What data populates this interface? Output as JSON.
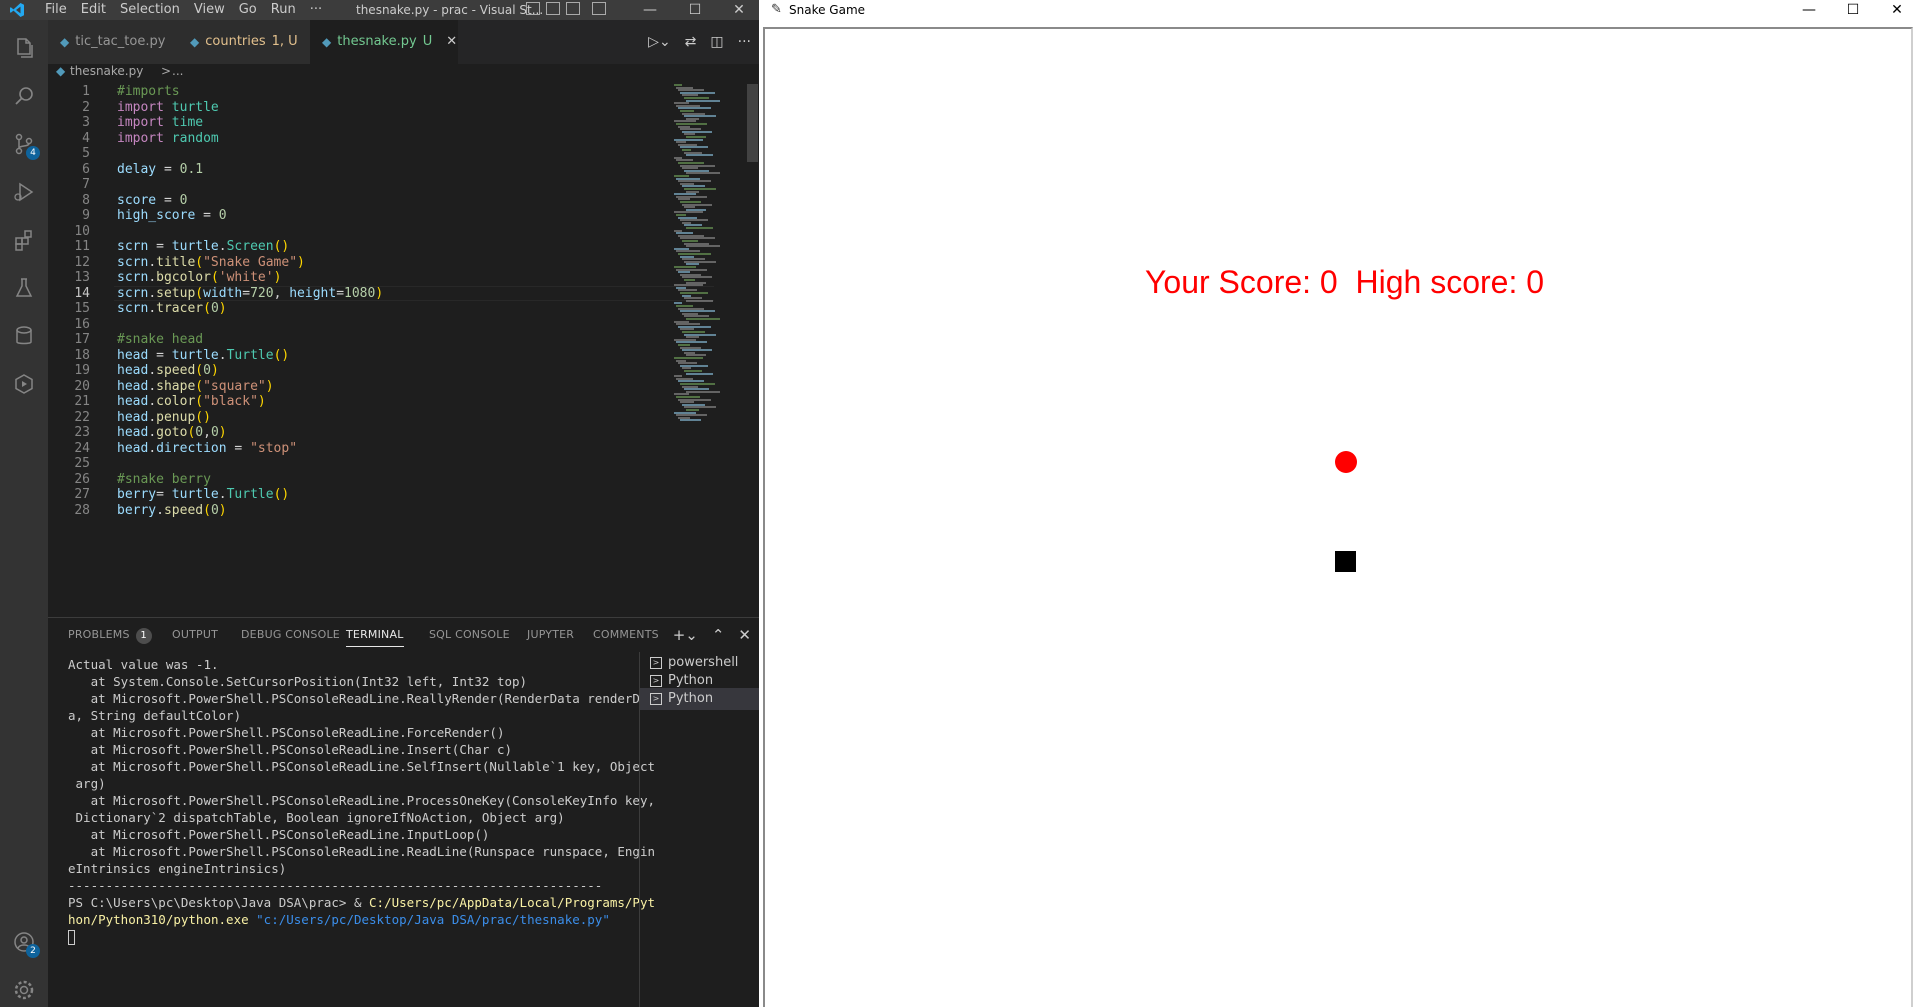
{
  "vscode": {
    "menu": [
      "File",
      "Edit",
      "Selection",
      "View",
      "Go",
      "Run",
      "···"
    ],
    "window_title": "thesnake.py - prac - Visual St...",
    "window_controls": {
      "minimize": "—",
      "maximize": "☐",
      "close": "✕"
    },
    "activity_badges": {
      "source_control": "4",
      "accounts": "2"
    },
    "tabs": [
      {
        "label": "tic_tac_toe.py",
        "status": ""
      },
      {
        "label": "countries",
        "status": "1, U"
      },
      {
        "label": "thesnake.py",
        "status": "U",
        "active": true
      }
    ],
    "breadcrumb": {
      "file": "thesnake.py",
      "sep": ">",
      "rest": "..."
    },
    "current_line": 14,
    "code_lines": [
      "#imports",
      "import turtle",
      "import time",
      "import random",
      "",
      "delay = 0.1",
      "",
      "score = 0",
      "high_score = 0",
      "",
      "scrn = turtle.Screen()",
      "scrn.title(\"Snake Game\")",
      "scrn.bgcolor('white')",
      "scrn.setup(width=720, height=1080)",
      "scrn.tracer(0)",
      "",
      "#snake head",
      "head = turtle.Turtle()",
      "head.speed(0)",
      "head.shape(\"square\")",
      "head.color(\"black\")",
      "head.penup()",
      "head.goto(0,0)",
      "head.direction = \"stop\"",
      "",
      "#snake berry",
      "berry= turtle.Turtle()",
      "berry.speed(0)"
    ],
    "panel": {
      "tabs": [
        "PROBLEMS",
        "OUTPUT",
        "DEBUG CONSOLE",
        "TERMINAL",
        "SQL CONSOLE",
        "JUPYTER",
        "COMMENTS"
      ],
      "problems_count": "1",
      "active_tab": "TERMINAL",
      "terminal_lines": [
        "Actual value was -1.",
        "   at System.Console.SetCursorPosition(Int32 left, Int32 top)",
        "   at Microsoft.PowerShell.PSConsoleReadLine.ReallyRender(RenderData renderDat",
        "a, String defaultColor)",
        "   at Microsoft.PowerShell.PSConsoleReadLine.ForceRender()",
        "   at Microsoft.PowerShell.PSConsoleReadLine.Insert(Char c)",
        "   at Microsoft.PowerShell.PSConsoleReadLine.SelfInsert(Nullable`1 key, Object",
        " arg)",
        "   at Microsoft.PowerShell.PSConsoleReadLine.ProcessOneKey(ConsoleKeyInfo key,",
        " Dictionary`2 dispatchTable, Boolean ignoreIfNoAction, Object arg)",
        "   at Microsoft.PowerShell.PSConsoleReadLine.InputLoop()",
        "   at Microsoft.PowerShell.PSConsoleReadLine.ReadLine(Runspace runspace, Engin",
        "eIntrinsics engineIntrinsics)",
        "-----------------------------------------------------------------------"
      ],
      "prompt": "PS C:\\Users\\pc\\Desktop\\Java DSA\\prac> & ",
      "command_path_line1": "C:/Users/pc/AppData/Local/Programs/Pyt",
      "command_path_line2": "hon/Python310/python.exe",
      "command_arg": " \"c:/Users/pc/Desktop/Java DSA/prac/thesnake.py\"",
      "terminals": [
        "powershell",
        "Python",
        "Python"
      ]
    }
  },
  "snake_game": {
    "title": "Snake Game",
    "window_controls": {
      "minimize": "—",
      "maximize": "☐",
      "close": "✕"
    },
    "score_text": "Your Score: 0  High score: 0",
    "score_color": "#ff0000",
    "berry_color": "#ff0000",
    "head_color": "#000000"
  }
}
